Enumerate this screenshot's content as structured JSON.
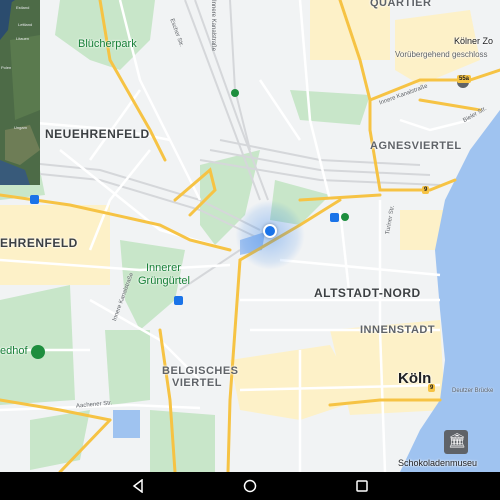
{
  "colors": {
    "map_bg": "#f1f3f4",
    "road_major": "#f6c344",
    "road_minor": "#ffffff",
    "park": "#c8e6c9",
    "water": "#9fc3f0",
    "rail": "#dadce0",
    "urban": "#fdf1c8",
    "location": "#1a73e8",
    "navbar": "#000000"
  },
  "minimap": {
    "labels": [
      "Estland",
      "Lettland",
      "Litauen",
      "Polen",
      "Ungarn"
    ]
  },
  "districts": {
    "neuehrenfeld": "NEUEHRENFELD",
    "ehrenfeld": "EHRENFELD",
    "altstadt_nord": "ALTSTADT-NORD",
    "agnesviertel": "AGNESVIERTEL",
    "innenstadt": "INNENSTADT",
    "belgisches_line1": "BELGISCHES",
    "belgisches_line2": "VIERTEL",
    "quartier": "QUARTIER"
  },
  "parks": {
    "bluecherpark": "Blücherpark",
    "gruenguertel_line1": "Innerer",
    "gruenguertel_line2": "Grüngürtel",
    "friedhof": "edhof"
  },
  "streets": {
    "escher_str": "Escher Str.",
    "inn_kanal_1": "Innere Kanalstraße",
    "inn_kanal_2": "Innere Kanalstraße",
    "bieler": "Bieler Str.",
    "aachener": "Aachener Str.",
    "deutzer_bruecke": "Deutzer Brücke",
    "turiner": "Turiner Str.",
    "inn_kanal_3": "Innere Kanalstraße"
  },
  "shields": {
    "s1": "55a",
    "s2": "9",
    "s3": "9"
  },
  "places": {
    "koeln": "Köln",
    "koelner_zoo": "Kölner Zo",
    "zoo_closed": "Vorübergehend geschloss",
    "schokoladenmuseum": "Schokoladenmuseu"
  },
  "navbar": {
    "back_icon": "triangle-back-icon",
    "home_icon": "circle-home-icon",
    "recents_icon": "square-recents-icon"
  }
}
